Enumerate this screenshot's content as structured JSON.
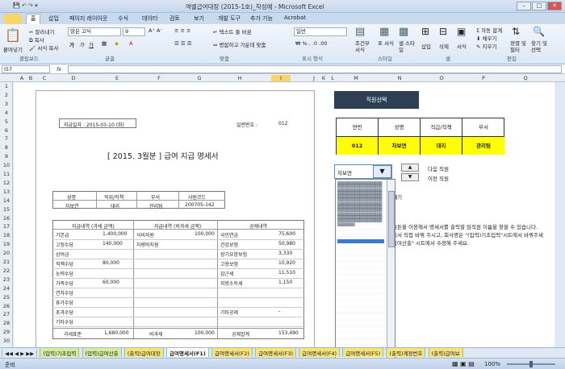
{
  "window": {
    "title": "역별급여대장 (2015-1호)_작성예 - Microsoft Excel"
  },
  "menu": {
    "items": [
      "홈",
      "삽입",
      "페이지 레이아웃",
      "수식",
      "데이터",
      "검토",
      "보기",
      "개발 도구",
      "추가 기능",
      "Acrobat"
    ]
  },
  "ribbon": {
    "paste": "붙여넣기",
    "cut": "잘라내기",
    "copy": "복사",
    "format_painter": "서식 복사",
    "font_name": "맑은 고딕",
    "font_size": "9",
    "wrap": "텍스트 줄 바꿈",
    "merge": "병합하고 가운데 맞춤",
    "number_format": "일반",
    "conditional": "조건부 서식",
    "table": "표 서식",
    "cell_style": "셀 스타일",
    "insert": "삽입",
    "delete": "삭제",
    "format": "서식",
    "autosum": "자동 합계",
    "fill": "채우기",
    "clear": "지우기",
    "sort": "정렬 및 필터",
    "find": "찾기 및 선택",
    "groups": [
      "클립보드",
      "글꼴",
      "맞춤",
      "표시 형식",
      "스타일",
      "셀",
      "편집"
    ]
  },
  "formula": {
    "namebox": "I57",
    "fx": "fx"
  },
  "columns": [
    "A",
    "B",
    "C",
    "D",
    "E",
    "F",
    "G",
    "H",
    "I",
    "J",
    "K",
    "L",
    "M",
    "N",
    "O",
    "P",
    "Q"
  ],
  "rows": [
    "1",
    "2",
    "3",
    "4",
    "5",
    "6",
    "7",
    "8",
    "9",
    "10",
    "11",
    "12",
    "13",
    "14",
    "15",
    "16",
    "17",
    "18",
    "19",
    "20",
    "21",
    "22",
    "23",
    "24",
    "25",
    "26",
    "27",
    "28",
    "29",
    "30",
    "31"
  ],
  "statement": {
    "pay_date": "지급일자 : 2015-03-10 (화)",
    "serial_label": "일련번호 :",
    "serial": "012",
    "title": "[ 2015. 3월분 ]  급여 지급 명세서",
    "emp_headers": [
      "성명",
      "직위/직책",
      "부서",
      "사원코드"
    ],
    "emp_values": [
      "차보연",
      "대리",
      "관리팀",
      "200705-142"
    ],
    "sec1": "지급내역 (과세 금액)",
    "sec2": "지급내역 (비과세 금액)",
    "sec3": "공제내역",
    "taxable": [
      [
        "기본급",
        "1,400,000"
      ],
      [
        "고정수당",
        "140,000"
      ],
      [
        "상여금",
        ""
      ],
      [
        "직책수당",
        "80,000"
      ],
      [
        "능력수당",
        ""
      ],
      [
        "가족수당",
        "60,000"
      ],
      [
        "연차수당",
        ""
      ],
      [
        "휴가수당",
        ""
      ],
      [
        "초과수당",
        ""
      ],
      [
        "기타수당",
        ""
      ]
    ],
    "nontax": [
      [
        "식비지원",
        "100,000"
      ],
      [
        "차량비지원",
        ""
      ]
    ],
    "deduct": [
      [
        "국민연금",
        "75,600"
      ],
      [
        "건강보험",
        "50,980"
      ],
      [
        "장기요양보험",
        "3,330"
      ],
      [
        "고용보험",
        "10,920"
      ],
      [
        "갑근세",
        "11,510"
      ],
      [
        "지방소득세",
        "1,150"
      ],
      [
        "",
        ""
      ],
      [
        "",
        ""
      ],
      [
        "기타공제",
        "-"
      ],
      [
        "",
        ""
      ]
    ],
    "totals": [
      "과세표준",
      "1,680,000",
      "비과세",
      "100,000",
      "공제합계",
      "153,490"
    ]
  },
  "panel": {
    "button": "직원선택",
    "headers": [
      "연번",
      "성명",
      "직급/직책",
      "부서"
    ],
    "values": [
      "012",
      "차보연",
      "대리",
      "관리팀"
    ],
    "combo": "차보연",
    "next": "다음 직원",
    "prev": "이전 직원",
    "note_frag": "/빼기",
    "info1": "버튼을 이용해서 명세서를 출력할 임직원 이름을 찾을 수 있습니다.",
    "info2": "기서 직접 바꿔 주시고, 회사명은 \"(입력)기초입력\"시트에서 바꿔주세",
    "info3": "급여산출\" 시트에서 수정해 주세요."
  },
  "sheets": [
    "(입력)기초입력",
    "(입력)급여산출",
    "(출력)급여대장",
    "급여명세서(F1)",
    "급여명세서(F2)",
    "급여명세서(F3)",
    "급여명세서(F4)",
    "급여명세서(F5)",
    "(출력)계정번호",
    "(출력)급여보"
  ],
  "status": {
    "ready": "준비",
    "zoom": "100%"
  }
}
